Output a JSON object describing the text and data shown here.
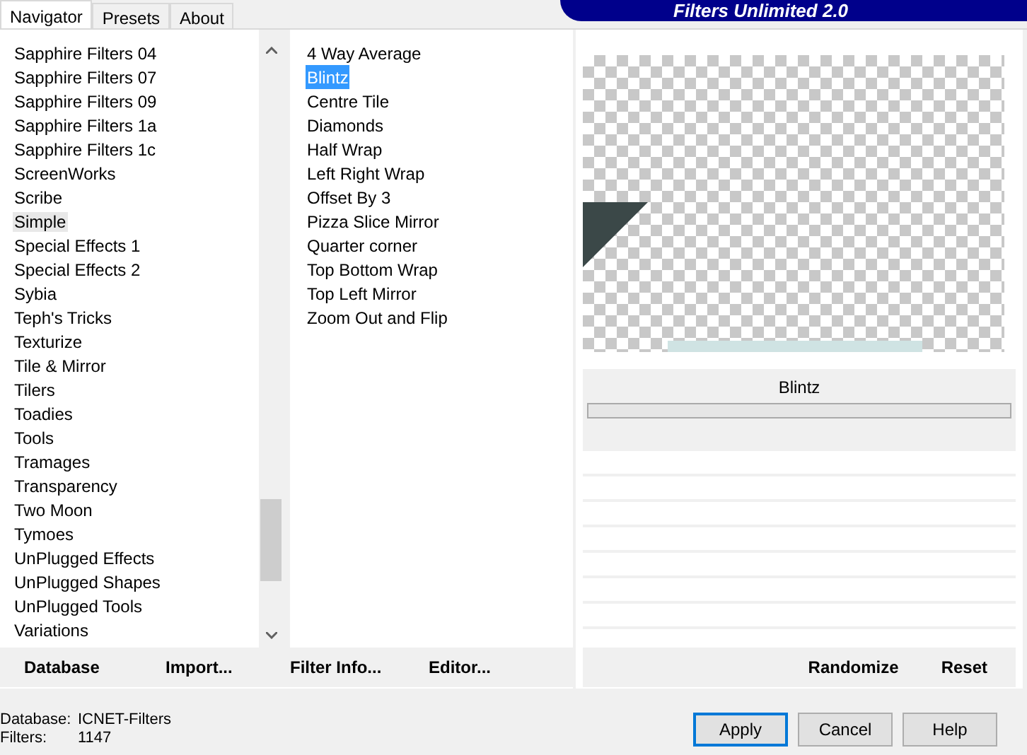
{
  "tabs": [
    {
      "label": "Navigator",
      "selected": true
    },
    {
      "label": "Presets",
      "selected": false
    },
    {
      "label": "About",
      "selected": false
    }
  ],
  "banner": "Filters Unlimited 2.0",
  "categories": [
    {
      "label": "Sapphire Filters 04",
      "selected": false
    },
    {
      "label": "Sapphire Filters 07",
      "selected": false
    },
    {
      "label": "Sapphire Filters 09",
      "selected": false
    },
    {
      "label": "Sapphire Filters 1a",
      "selected": false
    },
    {
      "label": "Sapphire Filters 1c",
      "selected": false
    },
    {
      "label": "ScreenWorks",
      "selected": false
    },
    {
      "label": "Scribe",
      "selected": false
    },
    {
      "label": "Simple",
      "selected": true
    },
    {
      "label": "Special Effects 1",
      "selected": false
    },
    {
      "label": "Special Effects 2",
      "selected": false
    },
    {
      "label": "Sybia",
      "selected": false
    },
    {
      "label": "Teph's Tricks",
      "selected": false
    },
    {
      "label": "Texturize",
      "selected": false
    },
    {
      "label": "Tile & Mirror",
      "selected": false
    },
    {
      "label": "Tilers",
      "selected": false
    },
    {
      "label": "Toadies",
      "selected": false
    },
    {
      "label": "Tools",
      "selected": false
    },
    {
      "label": "Tramages",
      "selected": false
    },
    {
      "label": "Transparency",
      "selected": false
    },
    {
      "label": "Two Moon",
      "selected": false
    },
    {
      "label": "Tymoes",
      "selected": false
    },
    {
      "label": "UnPlugged Effects",
      "selected": false
    },
    {
      "label": "UnPlugged Shapes",
      "selected": false
    },
    {
      "label": "UnPlugged Tools",
      "selected": false
    },
    {
      "label": "Variations",
      "selected": false
    }
  ],
  "filters": [
    {
      "label": "4 Way Average",
      "selected": false
    },
    {
      "label": "Blintz",
      "selected": true
    },
    {
      "label": "Centre Tile",
      "selected": false
    },
    {
      "label": "Diamonds",
      "selected": false
    },
    {
      "label": "Half Wrap",
      "selected": false
    },
    {
      "label": "Left Right Wrap",
      "selected": false
    },
    {
      "label": "Offset By 3",
      "selected": false
    },
    {
      "label": "Pizza Slice Mirror",
      "selected": false
    },
    {
      "label": "Quarter corner",
      "selected": false
    },
    {
      "label": "Top Bottom Wrap",
      "selected": false
    },
    {
      "label": "Top Left Mirror",
      "selected": false
    },
    {
      "label": "Zoom Out and Flip",
      "selected": false
    }
  ],
  "filter_name": "Blintz",
  "left_buttons": [
    "Database",
    "Import...",
    "Filter Info...",
    "Editor..."
  ],
  "right_buttons": [
    "Randomize",
    "Reset"
  ],
  "status": [
    {
      "label": "Database:",
      "value": "ICNET-Filters"
    },
    {
      "label": "Filters:",
      "value": "1147"
    }
  ],
  "dialog_buttons": [
    {
      "label": "Apply",
      "default": true
    },
    {
      "label": "Cancel",
      "default": false
    },
    {
      "label": "Help",
      "default": false
    }
  ]
}
